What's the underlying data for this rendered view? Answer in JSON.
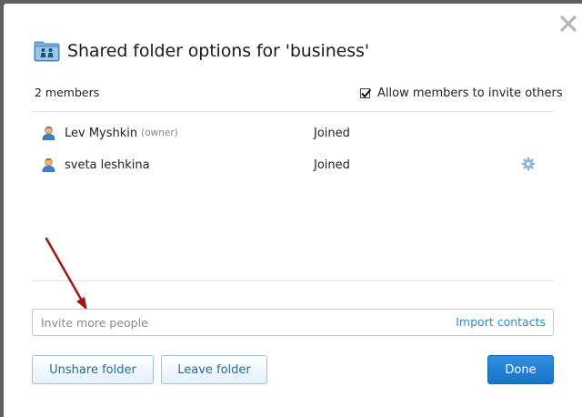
{
  "dialog": {
    "title": "Shared folder options for 'business'",
    "members_count": "2 members",
    "allow_invite_label": "Allow members to invite others",
    "allow_invite_checked": true
  },
  "members": [
    {
      "name": "Lev Myshkin",
      "role": "(owner)",
      "status": "Joined"
    },
    {
      "name": "sveta leshkina",
      "role": "",
      "status": "Joined"
    }
  ],
  "invite": {
    "placeholder": "Invite more people",
    "value": "",
    "import_label": "Import contacts"
  },
  "buttons": {
    "unshare": "Unshare folder",
    "leave": "Leave folder",
    "done": "Done"
  },
  "icons": {
    "close": "close-icon",
    "folder": "shared-folder-icon",
    "user": "user-icon",
    "gear": "gear-icon",
    "checkbox": "checkmark-icon",
    "annotation": "red-arrow-annotation"
  },
  "colors": {
    "primary": "#1a72c5",
    "link": "#2a8bd1",
    "arrow": "#a01515",
    "overlay": "#5f5f5f"
  }
}
